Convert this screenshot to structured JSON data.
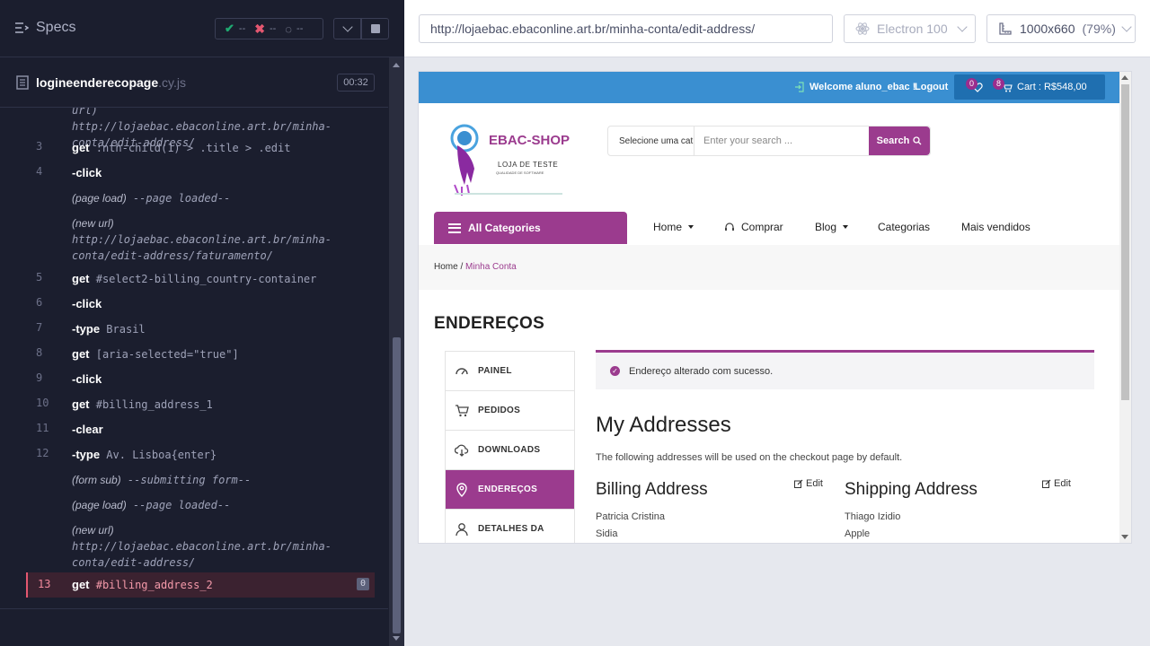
{
  "runner": {
    "specs_label": "Specs",
    "stats": {
      "passed": "--",
      "failed": "--",
      "pending": "--"
    },
    "spec_file": {
      "name": "logineenderecopage",
      "ext": ".cy.js",
      "duration": "00:32"
    },
    "commands": [
      {
        "num": "",
        "type": "url-cont",
        "text": "url) http://lojaebac.ebaconline.art.br/minha-conta/edit-address/"
      },
      {
        "num": "3",
        "type": "cmd",
        "name": "get",
        "arg": ":nth-child(1) > .title > .edit"
      },
      {
        "num": "4",
        "type": "cmd",
        "name": "-click",
        "arg": ""
      },
      {
        "num": "",
        "type": "evt",
        "name": "(page load)",
        "arg": "--page loaded--"
      },
      {
        "num": "",
        "type": "evt",
        "name": "(new url)",
        "arg": "http://lojaebac.ebaconline.art.br/minha-conta/edit-address/faturamento/"
      },
      {
        "num": "5",
        "type": "cmd",
        "name": "get",
        "arg": "#select2-billing_country-container"
      },
      {
        "num": "6",
        "type": "cmd",
        "name": "-click",
        "arg": ""
      },
      {
        "num": "7",
        "type": "cmd",
        "name": "-type",
        "arg": "Brasil"
      },
      {
        "num": "8",
        "type": "cmd",
        "name": "get",
        "arg": "[aria-selected=\"true\"]"
      },
      {
        "num": "9",
        "type": "cmd",
        "name": "-click",
        "arg": ""
      },
      {
        "num": "10",
        "type": "cmd",
        "name": "get",
        "arg": "#billing_address_1"
      },
      {
        "num": "11",
        "type": "cmd",
        "name": "-clear",
        "arg": ""
      },
      {
        "num": "12",
        "type": "cmd",
        "name": "-type",
        "arg": "Av. Lisboa{enter}"
      },
      {
        "num": "",
        "type": "evt",
        "name": "(form sub)",
        "arg": "--submitting form--"
      },
      {
        "num": "",
        "type": "evt",
        "name": "(page load)",
        "arg": "--page loaded--"
      },
      {
        "num": "",
        "type": "evt",
        "name": "(new url)",
        "arg": "http://lojaebac.ebaconline.art.br/minha-conta/edit-address/"
      },
      {
        "num": "13",
        "type": "active",
        "name": "get",
        "arg": "#billing_address_2",
        "badge": "0"
      }
    ]
  },
  "browser": {
    "url": "http://lojaebac.ebaconline.art.br/minha-conta/edit-address/",
    "browser_name": "Electron 100",
    "viewport": "1000x660",
    "zoom": "(79%)"
  },
  "site": {
    "welcome": "Welcome aluno_ebac !",
    "logout": "Logout",
    "wishlist_count": "0",
    "cart_count": "8",
    "cart_label": "Cart : R$548,00",
    "logo_title": "EBAC-SHOP",
    "logo_sub1": "LOJA DE TESTE",
    "logo_sub2": "QUALIDADE DE SOFTWARE",
    "search_category": "Selecione uma cat",
    "search_placeholder": "Enter your search ...",
    "search_button": "Search",
    "all_categories": "All Categories",
    "nav": [
      "Home",
      "Comprar",
      "Blog",
      "Categorias",
      "Mais vendidos"
    ],
    "breadcrumb": {
      "home": "Home",
      "sep": " / ",
      "current": "Minha Conta"
    },
    "page_title": "ENDEREÇOS",
    "account_menu": [
      "PAINEL",
      "PEDIDOS",
      "DOWNLOADS",
      "ENDEREÇOS",
      "DETALHES DA"
    ],
    "notice": "Endereço alterado com sucesso.",
    "my_addresses": "My Addresses",
    "addresses_desc": "The following addresses will be used on the checkout page by default.",
    "billing": {
      "title": "Billing Address",
      "edit": "Edit",
      "lines": [
        "Patricia Cristina",
        "Sidia"
      ]
    },
    "shipping": {
      "title": "Shipping Address",
      "edit": "Edit",
      "lines": [
        "Thiago Izidio",
        "Apple"
      ]
    }
  },
  "colors": {
    "runner_bg": "#1b1e2e",
    "brand_purple": "#9b3b8e",
    "topbar_blue": "#3a8fd1",
    "active_cmd": "#e45770"
  }
}
